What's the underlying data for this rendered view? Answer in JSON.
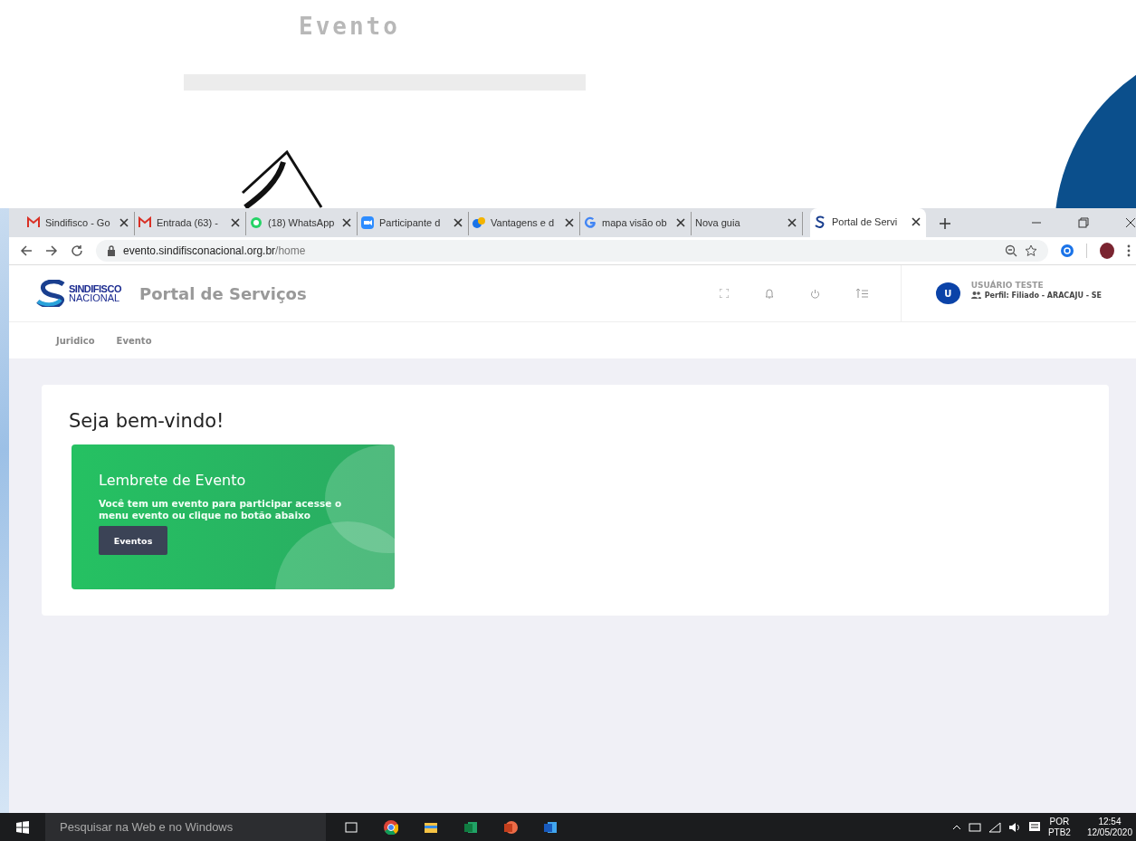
{
  "slide": {
    "title": "Evento"
  },
  "browser": {
    "tabs": [
      {
        "kind": "mail",
        "title": "Sindifisco - Go",
        "selected": false
      },
      {
        "kind": "mail",
        "title": "Entrada (63) - ",
        "selected": false
      },
      {
        "kind": "chat",
        "title": "(18) WhatsApp",
        "selected": false
      },
      {
        "kind": "video",
        "title": "Participante d",
        "selected": false
      },
      {
        "kind": "office",
        "title": "Vantagens e d",
        "selected": false
      },
      {
        "kind": "search",
        "title": "mapa visão ob",
        "selected": false
      },
      {
        "kind": "blank",
        "title": "Nova guia",
        "selected": false
      },
      {
        "kind": "site",
        "title": "Portal de Servi",
        "selected": true
      }
    ],
    "url_host": "evento.sindifisconacional.org.br",
    "url_path": "/home"
  },
  "header": {
    "logo_line1": "SINDIFISCO",
    "logo_line2": "NACIONAL",
    "title": "Portal de Serviços",
    "avatar": "U",
    "user_name": "USUÁRIO TESTE",
    "profile": "Perfil: Filiado - ARACAJU - SE"
  },
  "nav": [
    {
      "label": "Juridico"
    },
    {
      "label": "Evento"
    }
  ],
  "welcome": {
    "title": "Seja bem-vindo!",
    "reminder": {
      "title": "Lembrete de Evento",
      "text": "Você tem um evento para participar acesse o menu evento ou clique no botão abaixo",
      "button": "Eventos"
    }
  },
  "taskbar": {
    "search_placeholder": "Pesquisar na Web e no Windows",
    "language": "POR",
    "layout": "PTB2",
    "time": "12:54",
    "date": "12/05/2020"
  }
}
